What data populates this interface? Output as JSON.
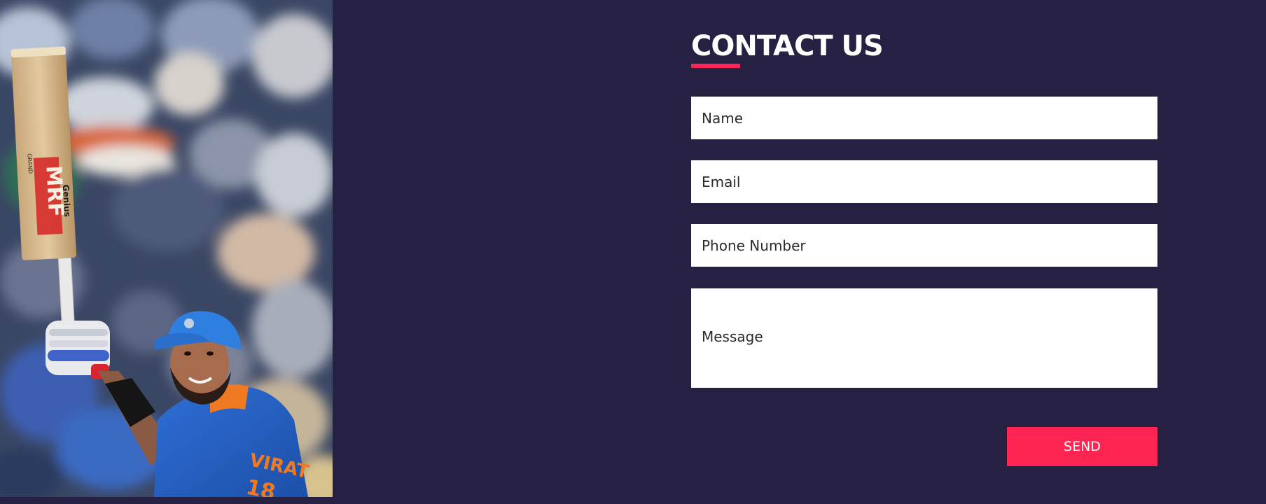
{
  "contact": {
    "title": "CONTACT US",
    "accent_color": "#ff2552",
    "background_color": "#262042",
    "fields": {
      "name": {
        "placeholder": "Name",
        "value": ""
      },
      "email": {
        "placeholder": "Email",
        "value": ""
      },
      "phone": {
        "placeholder": "Phone Number",
        "value": ""
      },
      "message": {
        "placeholder": "Message",
        "value": ""
      }
    },
    "send_label": "SEND"
  },
  "photo": {
    "description_icon": "cricketer-photo",
    "bat_brand": "MRF",
    "bat_model": "Genius",
    "bat_maker": "GRAND",
    "jersey_text": "VIRAT",
    "jersey_number": "18"
  }
}
